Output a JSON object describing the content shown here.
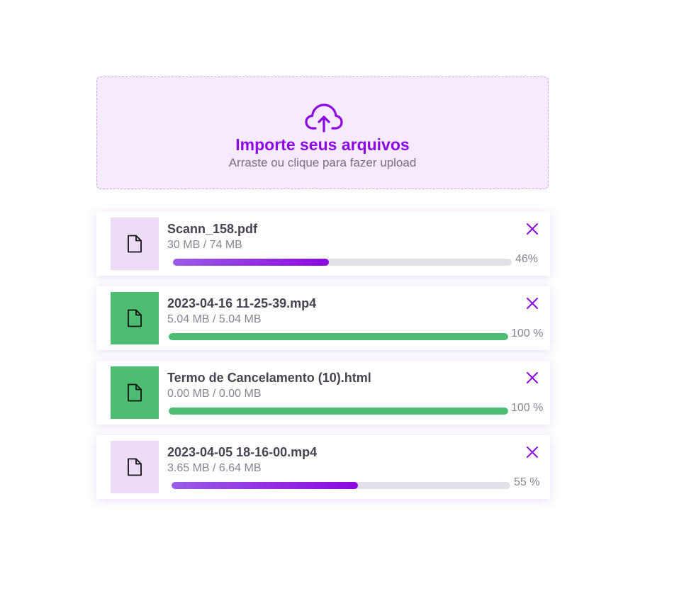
{
  "dropzone": {
    "icon": "cloud-upload-icon",
    "title": "Importe seus arquivos",
    "subtitle": "Arraste ou clique para fazer upload"
  },
  "colors": {
    "accent": "#8c08e0",
    "dropzone_bg": "#f5ebfd",
    "progress_start": "#9a5ce6",
    "progress_end": "#8c08e0",
    "complete": "#4dbd72",
    "pending_thumb": "#ecdcf8",
    "track": "#e3e0ea"
  },
  "files": [
    {
      "name": "Scann_158.pdf",
      "size": "30 MB / 74 MB",
      "progress": 46,
      "percent_label": "46%",
      "status": "uploading",
      "icon": "file-icon",
      "close_icon": "close-icon"
    },
    {
      "name": "2023-04-16 11-25-39.mp4",
      "size": "5.04 MB / 5.04 MB",
      "progress": 100,
      "percent_label": "100 %",
      "status": "complete",
      "icon": "file-icon",
      "close_icon": "close-icon"
    },
    {
      "name": "Termo de Cancelamento (10).html",
      "size": "0.00 MB / 0.00 MB",
      "progress": 100,
      "percent_label": "100 %",
      "status": "complete",
      "icon": "file-icon",
      "close_icon": "close-icon"
    },
    {
      "name": "2023-04-05 18-16-00.mp4",
      "size": "3.65 MB / 6.64 MB",
      "progress": 55,
      "percent_label": "55 %",
      "status": "uploading",
      "icon": "file-icon",
      "close_icon": "close-icon"
    }
  ]
}
